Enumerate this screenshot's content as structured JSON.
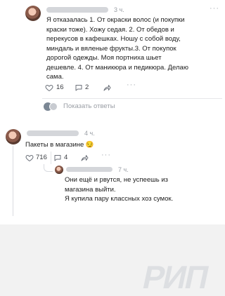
{
  "comment1": {
    "time": "3 ч.",
    "lines": [
      "Я отказалась 1. От окраски волос (и покупки",
      "краски тоже). Хожу седая. 2. От обедов и",
      "перекусов в кафешках. Ношу с собой воду,",
      "миндаль и вяленые фрукты.3. От покупок",
      "дорогой одежды. Моя портниха шьет",
      "дешевле. 4. От маникюра и педикюра. Делаю",
      "сама."
    ],
    "likes": "16",
    "replies": "2",
    "show_replies": "Показать ответы"
  },
  "comment2": {
    "time": "4 ч.",
    "text": "Пакеты в магазине 😏",
    "likes": "716",
    "replies": "4"
  },
  "reply": {
    "time": "7 ч.",
    "lines": [
      "Они ещё и рвутся, не успеешь из",
      "магазина выйти.",
      "Я купила пару классных хоз сумок."
    ]
  },
  "watermark": "РИП"
}
